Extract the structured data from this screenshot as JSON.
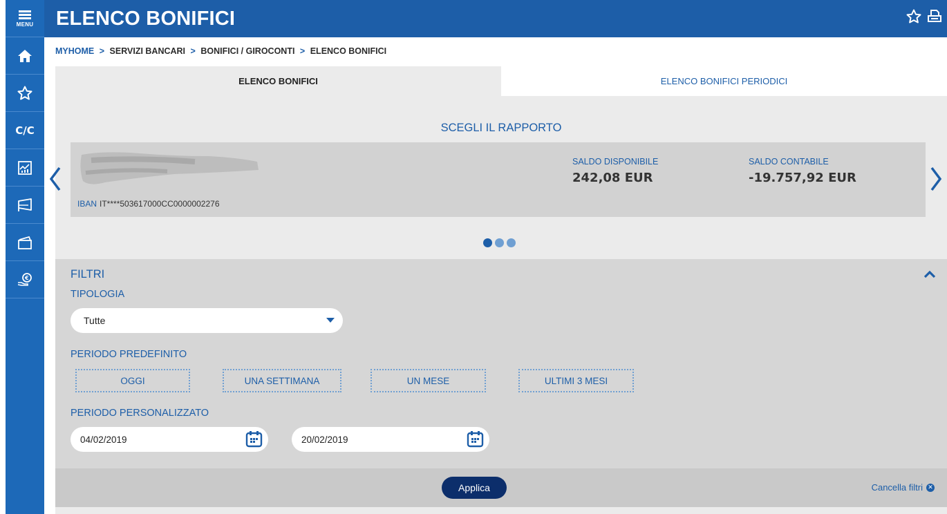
{
  "sidebar": {
    "menu_label": "MENU",
    "items": [
      {
        "icon": "home-icon"
      },
      {
        "icon": "star-icon"
      },
      {
        "label": "C/C"
      },
      {
        "icon": "chart-icon"
      },
      {
        "icon": "megaphone-icon"
      },
      {
        "icon": "card-icon"
      },
      {
        "icon": "euro-hand-icon"
      }
    ]
  },
  "header": {
    "title": "ELENCO BONIFICI"
  },
  "breadcrumb": {
    "home": "MYHOME",
    "sep": ">",
    "items": [
      "SERVIZI BANCARI",
      "BONIFICI / GIROCONTI",
      "ELENCO BONIFICI"
    ]
  },
  "tabs": [
    {
      "label": "ELENCO BONIFICI",
      "active": true
    },
    {
      "label": "ELENCO BONIFICI PERIODICI",
      "active": false
    }
  ],
  "rapporto": {
    "title": "SCEGLI IL RAPPORTO",
    "iban_label": "IBAN",
    "iban_value": "IT****503617000CC0000002276",
    "saldo_disponibile_label": "SALDO DISPONIBILE",
    "saldo_disponibile_value": "242,08 EUR",
    "saldo_contabile_label": "SALDO CONTABILE",
    "saldo_contabile_value": "-19.757,92 EUR",
    "pager": {
      "count": 3,
      "active_index": 0
    }
  },
  "filters": {
    "title": "FILTRI",
    "tipologia_label": "TIPOLOGIA",
    "tipologia_value": "Tutte",
    "periodo_label": "PERIODO PREDEFINITO",
    "periodo_options": [
      "OGGI",
      "UNA SETTIMANA",
      "UN MESE",
      "ULTIMI 3 MESI"
    ],
    "personalizzato_label": "PERIODO PERSONALIZZATO",
    "date_from": "04/02/2019",
    "date_to": "20/02/2019",
    "apply_label": "Applica",
    "clear_label": "Cancella filtri"
  },
  "colors": {
    "brand_blue": "#1d5ea8",
    "sidebar_blue": "#1d69b8",
    "apply_navy": "#0c2e6b"
  }
}
